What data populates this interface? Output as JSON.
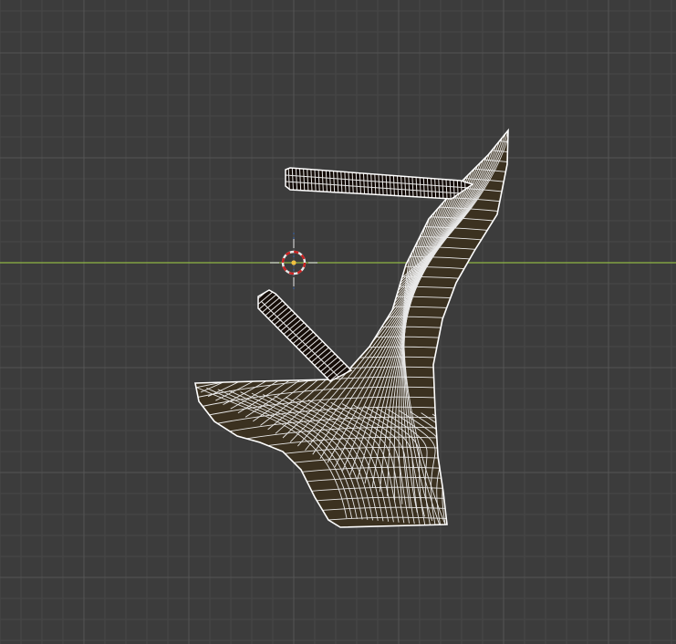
{
  "viewport": {
    "background": "#3c3c3c",
    "grid_minor_color": "#474747",
    "grid_major_color": "#555555",
    "x_axis_color": "#8fb644",
    "y_axis_color": "#3a67b0"
  },
  "object": {
    "display_mode": "wireframe",
    "wire_color": "#e8e8e8",
    "fill_color": "#3b3120",
    "dark_fill_color": "#160d08"
  },
  "cursor_3d": {
    "ring_colors": [
      "#e8e8e8",
      "#cc2020"
    ],
    "icon": "3d-cursor-icon"
  }
}
